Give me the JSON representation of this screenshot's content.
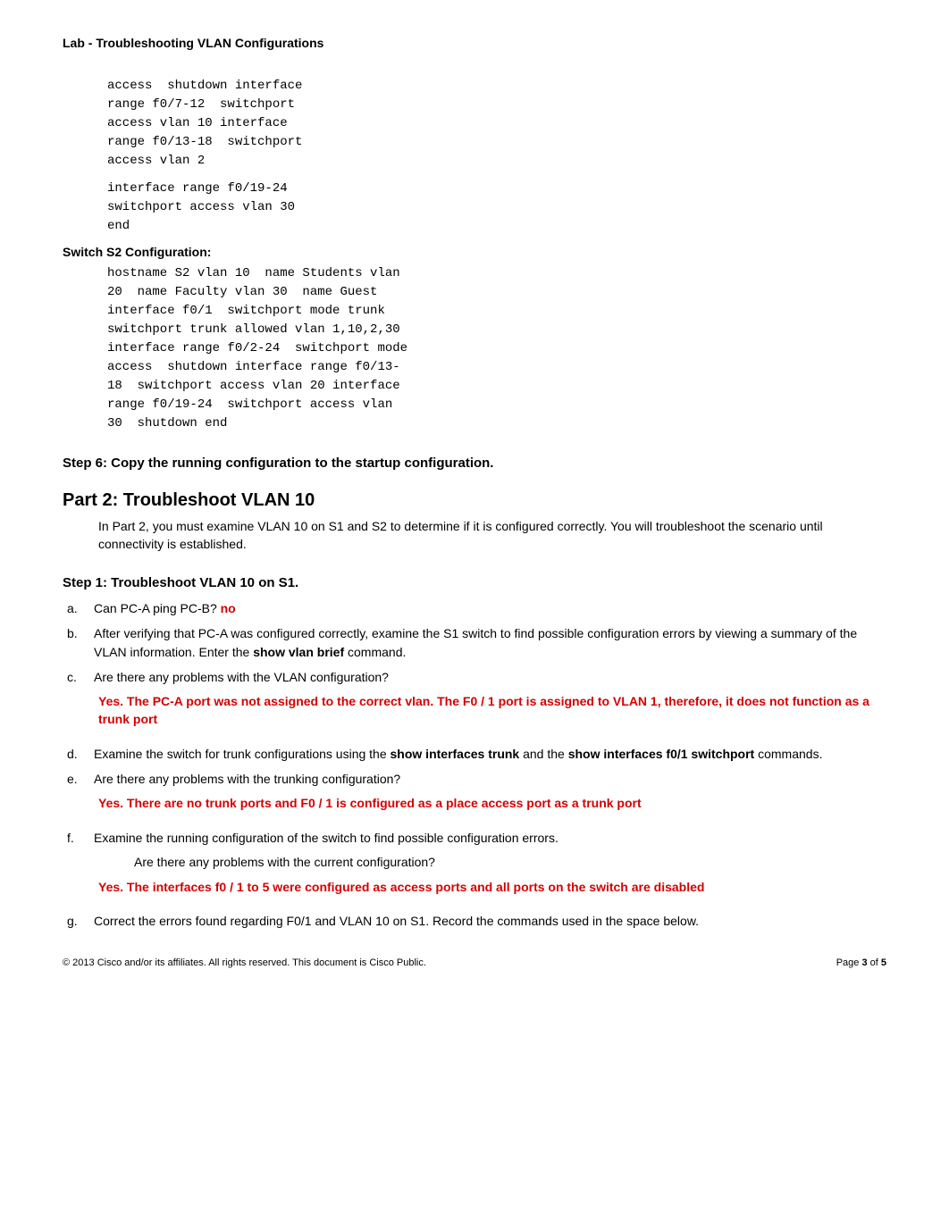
{
  "header": {
    "title": "Lab - Troubleshooting VLAN Configurations"
  },
  "code1": "access  shutdown interface\nrange f0/7-12  switchport\naccess vlan 10 interface\nrange f0/13-18  switchport\naccess vlan 2",
  "code2": "interface range f0/19-24\nswitchport access vlan 30\nend",
  "s2": {
    "heading": "Switch S2 Configuration:",
    "code": "hostname S2 vlan 10  name Students vlan\n20  name Faculty vlan 30  name Guest\ninterface f0/1  switchport mode trunk\nswitchport trunk allowed vlan 1,10,2,30\ninterface range f0/2-24  switchport mode\naccess  shutdown interface range f0/13-\n18  switchport access vlan 20 interface\nrange f0/19-24  switchport access vlan\n30  shutdown end"
  },
  "step6": {
    "heading": "Step 6: Copy the running configuration to the startup configuration."
  },
  "part2": {
    "heading": "Part 2: Troubleshoot VLAN 10",
    "intro": "In Part 2, you must examine VLAN 10 on S1 and S2 to determine if it is configured correctly. You will troubleshoot the scenario until connectivity is established."
  },
  "step1": {
    "heading": "Step 1: Troubleshoot VLAN 10 on S1.",
    "a": {
      "marker": "a.",
      "q": "Can PC-A ping PC-B?  ",
      "ans": "no"
    },
    "b": {
      "marker": "b.",
      "text1": "After verifying that PC-A was configured correctly, examine the S1 switch to find possible configuration errors by viewing a summary of the VLAN information. Enter the ",
      "cmd": "show vlan brief",
      "text2": " command."
    },
    "c": {
      "marker": "c.",
      "q": "Are there any problems with the VLAN configuration?",
      "ans": " Yes. The PC-A port was not assigned to the correct vlan. The F0 / 1 port is assigned to VLAN 1, therefore, it does not function as a trunk port"
    },
    "d": {
      "marker": "d.",
      "t1": "Examine the switch for trunk configurations using the ",
      "c1": "show interfaces trunk",
      "t2": " and the ",
      "c2": "show interfaces f0/1 switchport",
      "t3": " commands."
    },
    "e": {
      "marker": "e.",
      "q": "Are there any problems with the trunking configuration?",
      "ans": " Yes. There are no trunk ports and F0 / 1 is configured as a place access port as a trunk port"
    },
    "f": {
      "marker": "f.",
      "q": "Examine the running configuration of the switch to find possible configuration errors.",
      "sub": "Are there any problems with the current configuration?",
      "ans": " Yes. The interfaces f0 / 1 to 5 were configured as access ports and all ports on the switch are disabled"
    },
    "g": {
      "marker": "g.",
      "q": "Correct the errors found regarding F0/1 and VLAN 10 on S1. Record the commands used in the space below."
    }
  },
  "footer": {
    "left": "© 2013 Cisco and/or its affiliates. All rights reserved. This document is Cisco Public.",
    "right_prefix": "Page ",
    "page": "3",
    "of": " of ",
    "total": "5"
  }
}
